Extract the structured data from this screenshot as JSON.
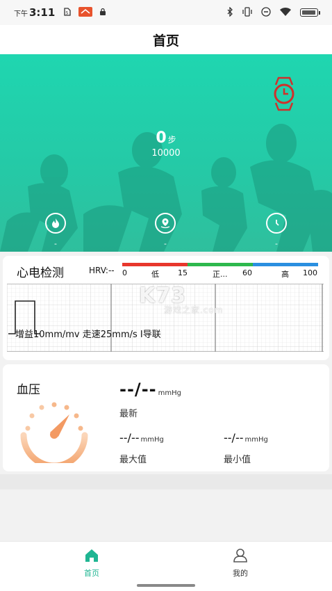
{
  "status_bar": {
    "time_prefix": "下午",
    "time": "3:11",
    "icons": [
      "sim-icon",
      "app-notification-icon",
      "lock-icon",
      "bluetooth-icon",
      "vibrate-icon",
      "dnd-icon",
      "wifi-icon",
      "battery-icon"
    ]
  },
  "header": {
    "title": "首页"
  },
  "hero": {
    "steps_value": "0",
    "steps_unit": "步",
    "steps_goal": "10000",
    "stats": [
      {
        "icon": "flame-icon",
        "value": "-"
      },
      {
        "icon": "location-icon",
        "value": "-"
      },
      {
        "icon": "clock-icon",
        "value": "-"
      }
    ],
    "watch_icon": "watch-icon"
  },
  "ecg": {
    "title": "心电检测",
    "hrv_label": "HRV:--",
    "scale": [
      "0",
      "低",
      "15",
      "正...",
      "60",
      "高",
      "100"
    ],
    "bar_colors": [
      "#e8372c",
      "#2db84d",
      "#2a8fe0"
    ],
    "caption": "增益10mm/mv 走速25mm/s I导联"
  },
  "watermark": {
    "main": "K73",
    "sub": "游戏之家",
    "domain": ".com"
  },
  "blood_pressure": {
    "title": "血压",
    "latest_value": "--/--",
    "unit": "mmHg",
    "latest_label": "最新",
    "max_value": "--/--",
    "max_label": "最大值",
    "min_value": "--/--",
    "min_label": "最小值"
  },
  "bottom_nav": {
    "items": [
      {
        "label": "首页",
        "icon": "home-icon",
        "active": true
      },
      {
        "label": "我的",
        "icon": "profile-icon",
        "active": false
      }
    ],
    "active_color": "#1fb592"
  }
}
